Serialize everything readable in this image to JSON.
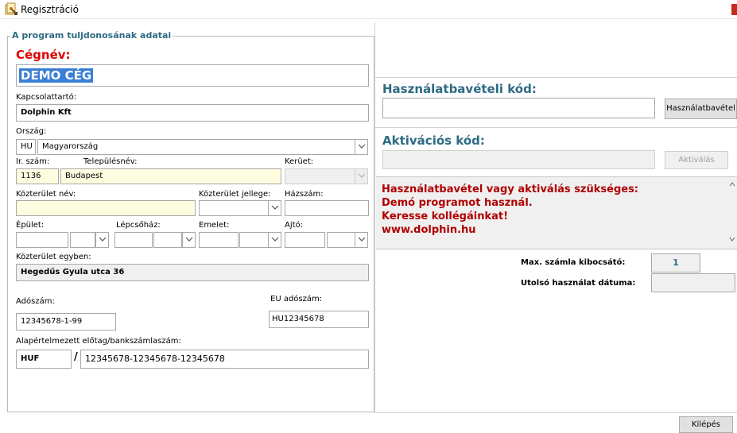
{
  "window": {
    "title": "Regisztráció"
  },
  "owner_group": {
    "title": "A program tuljdonosának adatai"
  },
  "company": {
    "label": "Cégnév:",
    "value": "DEMO CÉG"
  },
  "contact": {
    "label": "Kapcsolattartó:",
    "value": "Dolphin Kft"
  },
  "country": {
    "label": "Ország:",
    "code": "HU",
    "name": "Magyarország"
  },
  "zip": {
    "label": "Ir. szám:",
    "value": "1136"
  },
  "city": {
    "label": "Településnév:",
    "value": "Budapest"
  },
  "district": {
    "label": "Kerüet:",
    "value": ""
  },
  "street": {
    "label": "Közterület név:",
    "value": ""
  },
  "street_type": {
    "label": "Közterület jellege:",
    "value": ""
  },
  "house_number": {
    "label": "Házszám:",
    "value": ""
  },
  "building": {
    "label": "Épület:",
    "value": ""
  },
  "staircase": {
    "label": "Lépcsőház:",
    "value": ""
  },
  "floor": {
    "label": "Emelet:",
    "value": ""
  },
  "door": {
    "label": "Ajtó:",
    "value": ""
  },
  "street_together": {
    "label": "Közterület egyben:",
    "value": "Hegedűs Gyula utca 36"
  },
  "tax_number": {
    "label": "Adószám:",
    "value": "12345678-1-99"
  },
  "eu_tax_number": {
    "label": "EU adószám:",
    "value": "HU12345678"
  },
  "bank": {
    "label": "Alapértelmezett előtag/bankszámlaszám:",
    "prefix": "HUF",
    "separator": "/",
    "account": "12345678-12345678-12345678"
  },
  "usage_code": {
    "label": "Használatbavételi kód:",
    "value": "",
    "button": "Használatbavétel"
  },
  "activation_code": {
    "label": "Aktivációs kód:",
    "value": "",
    "button": "Aktiválás"
  },
  "message": {
    "color": "#b00000",
    "lines": [
      "Használatbavétel vagy aktiválás szükséges:",
      "Demó programot használ.",
      "Keresse kollégáinkat!",
      "www.dolphin.hu"
    ]
  },
  "stats": {
    "max_invoice_label": "Max. számla kibocsátó:",
    "max_invoice_value": "1",
    "last_use_label": "Utolsó használat dátuma:",
    "last_use_value": ""
  },
  "footer": {
    "exit_button": "Kilépés"
  },
  "colors": {
    "accent": "#2e6b84",
    "required": "#e00000",
    "selection": "#3a7fd5",
    "highlight_field": "#fffde0"
  }
}
